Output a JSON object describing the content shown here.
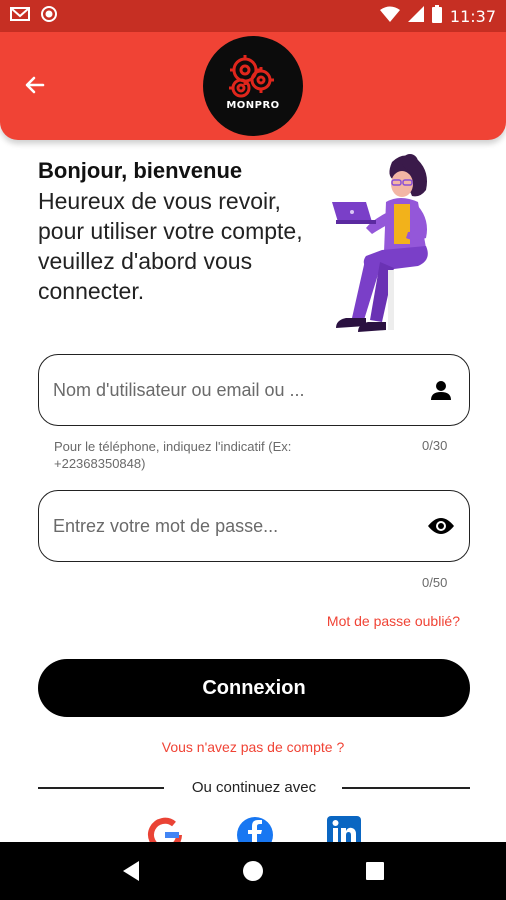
{
  "status_bar": {
    "time": "11:37",
    "icons": [
      "gmail-icon",
      "notification-dot-icon",
      "wifi-icon",
      "signal-icon",
      "battery-icon"
    ]
  },
  "header": {
    "back_icon": "arrow-left-icon",
    "logo_text": "MONPRO"
  },
  "welcome": {
    "title": "Bonjour, bienvenue",
    "message": "Heureux de vous revoir, pour utiliser votre compte, veuillez d'abord vous connecter."
  },
  "username_field": {
    "value": "",
    "placeholder": "Nom d'utilisateur ou email ou ...",
    "icon": "person-icon",
    "helper": "Pour le téléphone, indiquez l'indicatif (Ex: +22368350848)",
    "counter": "0/30"
  },
  "password_field": {
    "value": "",
    "placeholder": "Entrez votre mot de passe...",
    "icon": "eye-icon",
    "counter": "0/50"
  },
  "forgot_password": "Mot de passe oublié?",
  "login_button": "Connexion",
  "signup_link": "Vous n'avez pas de compte ?",
  "divider_text": "Ou continuez avec",
  "social": [
    "google-icon",
    "facebook-icon",
    "linkedin-icon"
  ],
  "nav_bar": [
    "back-nav-icon",
    "home-nav-icon",
    "recents-nav-icon"
  ],
  "colors": {
    "primary": "#f04335",
    "status_bar": "#c62f23",
    "button": "#000000",
    "link": "#f04335",
    "illustration_purple": "#8a4fd6"
  }
}
